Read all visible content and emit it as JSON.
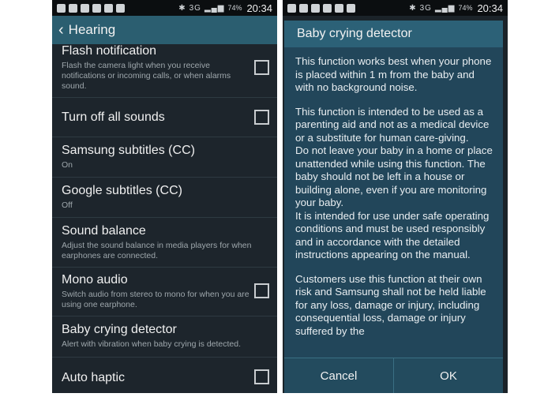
{
  "statusbar": {
    "battery": "74%",
    "time": "20:34",
    "network": "3G"
  },
  "hearing": {
    "title": "Hearing",
    "items": [
      {
        "title": "Flash notification",
        "sub": "Flash the camera light when you receive notifications or incoming calls, or when alarms sound.",
        "checkbox": true
      },
      {
        "title": "Turn off all sounds",
        "sub": "",
        "checkbox": true
      },
      {
        "title": "Samsung subtitles (CC)",
        "sub": "On",
        "checkbox": false
      },
      {
        "title": "Google subtitles (CC)",
        "sub": "Off",
        "checkbox": false
      },
      {
        "title": "Sound balance",
        "sub": "Adjust the sound balance in media players for when earphones are connected.",
        "checkbox": false
      },
      {
        "title": "Mono audio",
        "sub": "Switch audio from stereo to mono for when you are using one earphone.",
        "checkbox": true
      },
      {
        "title": "Baby crying detector",
        "sub": "Alert with vibration when baby crying is detected.",
        "checkbox": false
      },
      {
        "title": "Auto haptic",
        "sub": "",
        "checkbox": true
      }
    ]
  },
  "dialog": {
    "title": "Baby crying detector",
    "p1": "This function works best when your phone is placed within 1 m from the baby and with no background noise.",
    "p2": "This function is intended to be used as a parenting aid and not as a medical device or a substitute for human care-giving.",
    "p3": "Do not leave your baby in a home or place unattended while using this function. The baby should not be left in a house or building alone, even if you are monitoring your baby.",
    "p4": "It is intended for use under safe operating conditions and must be used responsibly and in accordance with the detailed instructions appearing on the manual.",
    "p5": "Customers use this function at their own risk and Samsung shall not be held liable for any loss, damage or injury, including consequential loss, damage or injury suffered by the",
    "cancel": "Cancel",
    "ok": "OK"
  }
}
